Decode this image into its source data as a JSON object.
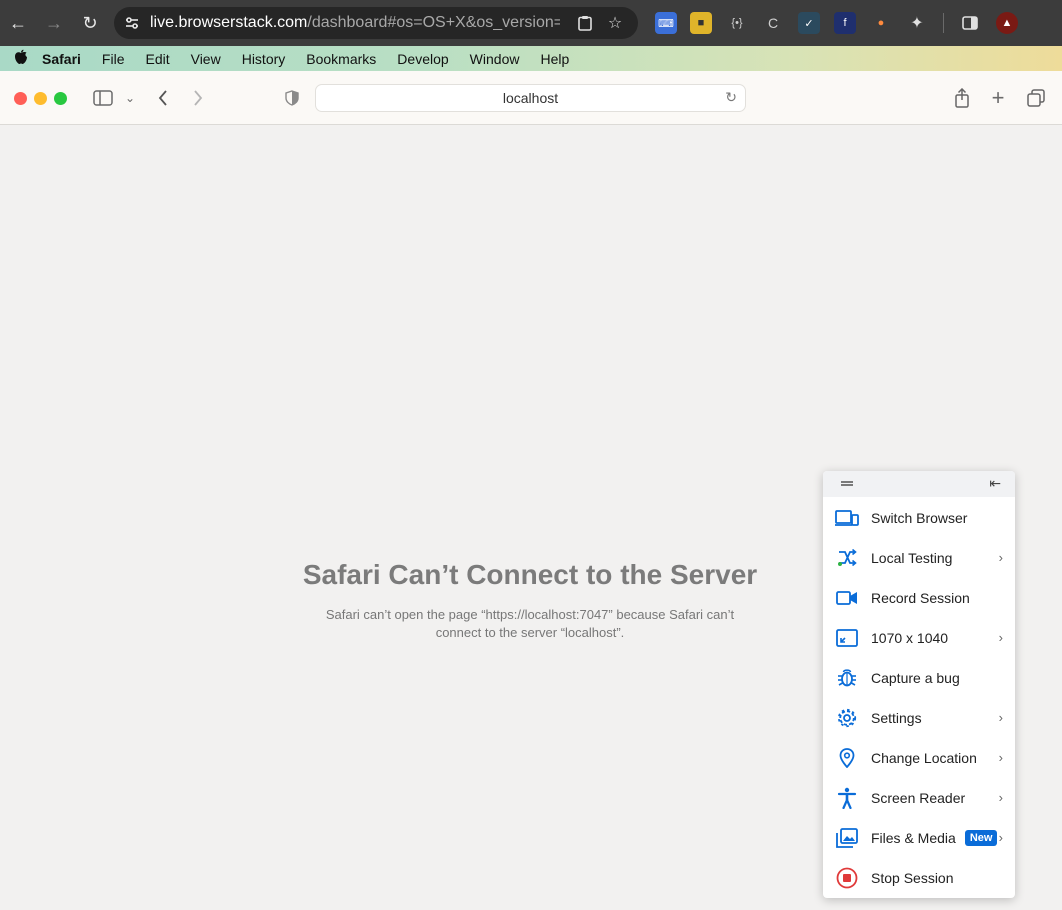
{
  "chrome": {
    "url_host": "live.browserstack.com",
    "url_rest": "/dashboard#os=OS+X&os_version=Ve..."
  },
  "menubar": {
    "items": [
      "Safari",
      "File",
      "Edit",
      "View",
      "History",
      "Bookmarks",
      "Develop",
      "Window",
      "Help"
    ]
  },
  "safari": {
    "address": "localhost"
  },
  "error": {
    "title": "Safari Can’t Connect to the Server",
    "message": "Safari can’t open the page “https://localhost:7047” because Safari can’t connect to the server “localhost”."
  },
  "panel": {
    "items": [
      {
        "label": "Switch Browser",
        "icon": "switch-browser-icon"
      },
      {
        "label": "Local Testing",
        "icon": "local-testing-icon"
      },
      {
        "label": "Record Session",
        "icon": "video-camera-icon"
      },
      {
        "label": "1070 x 1040",
        "icon": "resolution-icon"
      },
      {
        "label": "Capture a bug",
        "icon": "bug-icon"
      },
      {
        "label": "Settings",
        "icon": "gear-icon"
      },
      {
        "label": "Change Location",
        "icon": "location-pin-icon"
      },
      {
        "label": "Screen Reader",
        "icon": "accessibility-icon"
      },
      {
        "label": "Files & Media",
        "icon": "media-icon",
        "badge": "New"
      },
      {
        "label": "Stop Session",
        "icon": "stop-icon"
      }
    ]
  },
  "colors": {
    "accent": "#0a6cd8",
    "stop": "#e03a3a",
    "close": "#ff5f57",
    "minimize": "#febc2e",
    "zoom": "#28c840"
  }
}
